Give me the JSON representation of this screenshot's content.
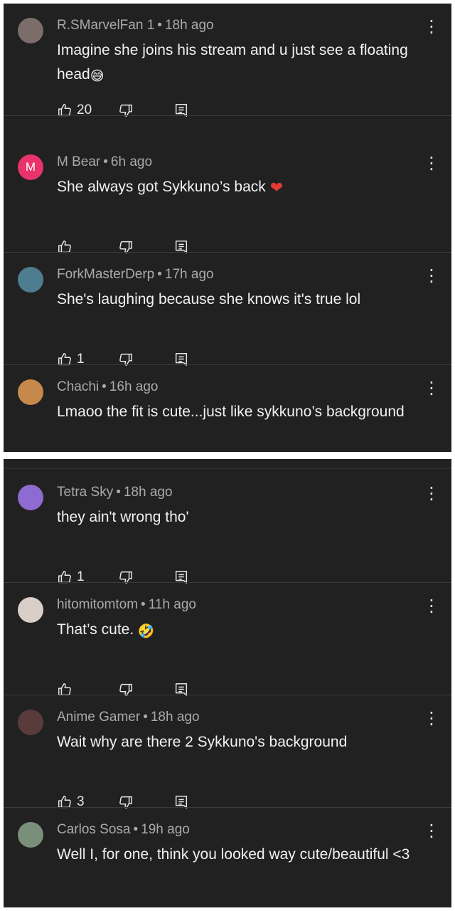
{
  "top_comments": [
    {
      "author": "R.SMarvelFan 1",
      "time": "18h ago",
      "text": "Imagine she joins his stream and u just see a floating head",
      "emoji": "😅",
      "likes": "20",
      "avatar_color": "#7a6d6a"
    },
    {
      "author": "M Bear",
      "time": "6h ago",
      "text": "She always got Sykkuno’s back",
      "emoji": "❤",
      "likes": "",
      "avatar_letter": "M",
      "avatar_color": "#e8336b"
    },
    {
      "author": "ForkMasterDerp",
      "time": "17h ago",
      "text": "She's laughing because she knows it's true lol",
      "emoji": "",
      "likes": "1",
      "avatar_color": "#4e7d8f"
    },
    {
      "author": "Chachi",
      "time": "16h ago",
      "text": "Lmaoo the fit is cute...just like sykkuno’s background",
      "emoji": "",
      "likes": "",
      "avatar_color": "#c6894b"
    }
  ],
  "bottom_comments": [
    {
      "author": "Tetra Sky",
      "time": "18h ago",
      "text": "they ain't wrong tho'",
      "emoji": "",
      "likes": "1",
      "avatar_color": "#8e6bd0"
    },
    {
      "author": "hitomitomtom",
      "time": "11h ago",
      "text": "That’s cute.",
      "emoji": "🤣",
      "likes": "",
      "avatar_color": "#d9cfc8"
    },
    {
      "author": "Anime Gamer",
      "time": "18h ago",
      "text": "Wait why are there 2 Sykkuno's background",
      "emoji": "",
      "likes": "3",
      "avatar_color": "#5a3b3b"
    },
    {
      "author": "Carlos Sosa",
      "time": "19h ago",
      "text": "Well I, for one, think you looked way cute/beautiful <3",
      "emoji": "",
      "likes": "",
      "avatar_color": "#7a8f7a"
    }
  ],
  "meta_separator": "•",
  "more_glyph": "⋮",
  "icons": {
    "like": "thumbs-up-icon",
    "dislike": "thumbs-down-icon",
    "reply": "comment-icon",
    "more": "more-vert-icon"
  },
  "colors": {
    "background": "#212121",
    "text": "#f1f1f1",
    "meta": "#aaaaaa"
  }
}
